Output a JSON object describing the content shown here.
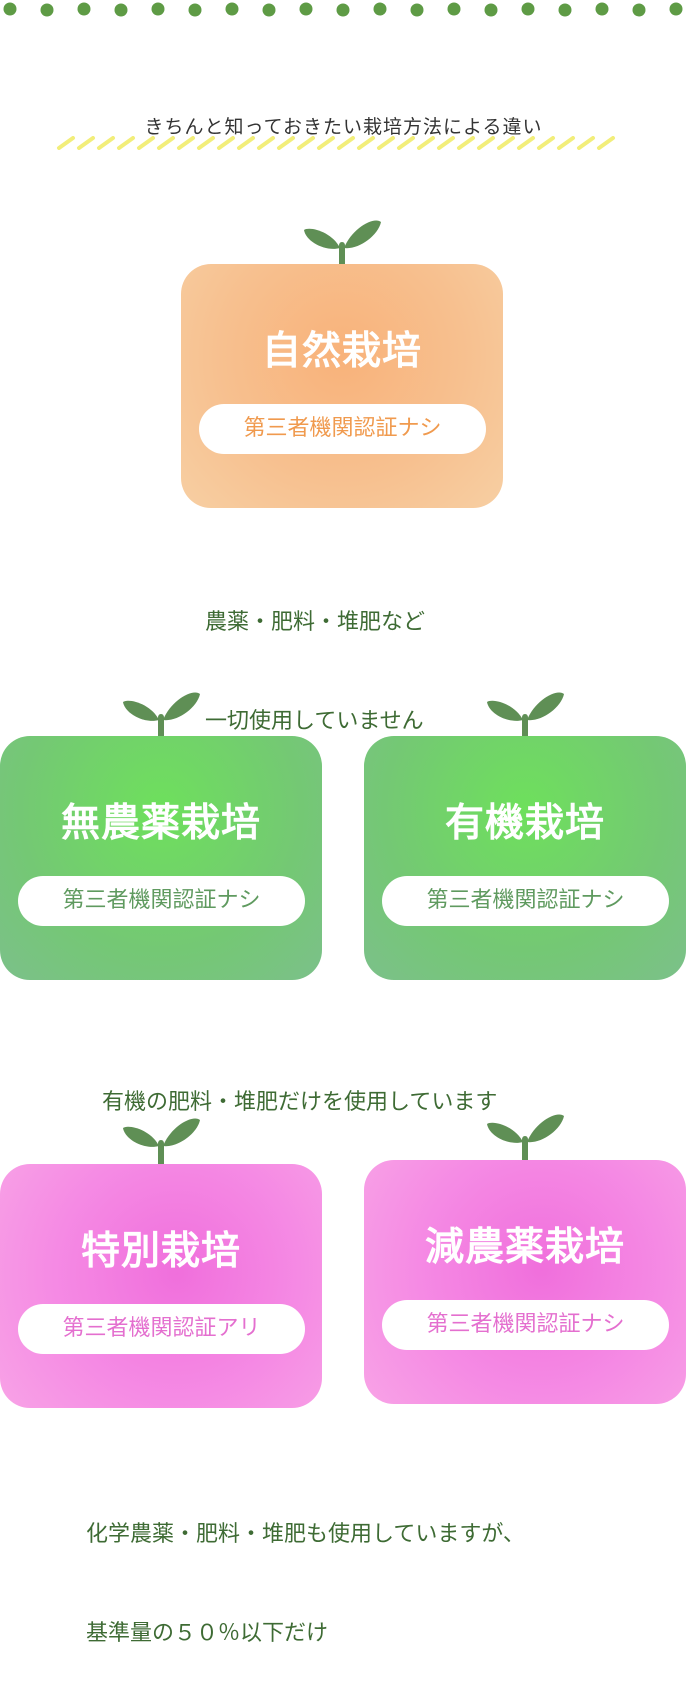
{
  "heading": "きちんと知っておきたい栽培方法による違い",
  "colors": {
    "dots": "#5e9b45",
    "sprout": "#5f8f55",
    "underline": "#f2ee7a",
    "text": "#3e6b34"
  },
  "cards": [
    {
      "title": "自然栽培",
      "badge": "第三者機関認証ナシ",
      "color": "orange"
    },
    {
      "title": "無農薬栽培",
      "badge": "第三者機関認証ナシ",
      "color": "green"
    },
    {
      "title": "有機栽培",
      "badge": "第三者機関認証ナシ",
      "color": "green"
    },
    {
      "title": "特別栽培",
      "badge": "第三者機関認証アリ",
      "color": "pink"
    },
    {
      "title": "減農薬栽培",
      "badge": "第三者機関認証ナシ",
      "color": "pink"
    }
  ],
  "descriptions": [
    {
      "lines": [
        "農薬・肥料・堆肥など",
        "一切使用していません"
      ]
    },
    {
      "lines": [
        "有機の肥料・堆肥だけを使用しています"
      ]
    },
    {
      "lines": [
        "化学農薬・肥料・堆肥も使用していますが、",
        "基準量の５０％以下だけ"
      ]
    }
  ],
  "icons": {
    "sprout": "sprout-icon",
    "dots": "dotted-border"
  }
}
